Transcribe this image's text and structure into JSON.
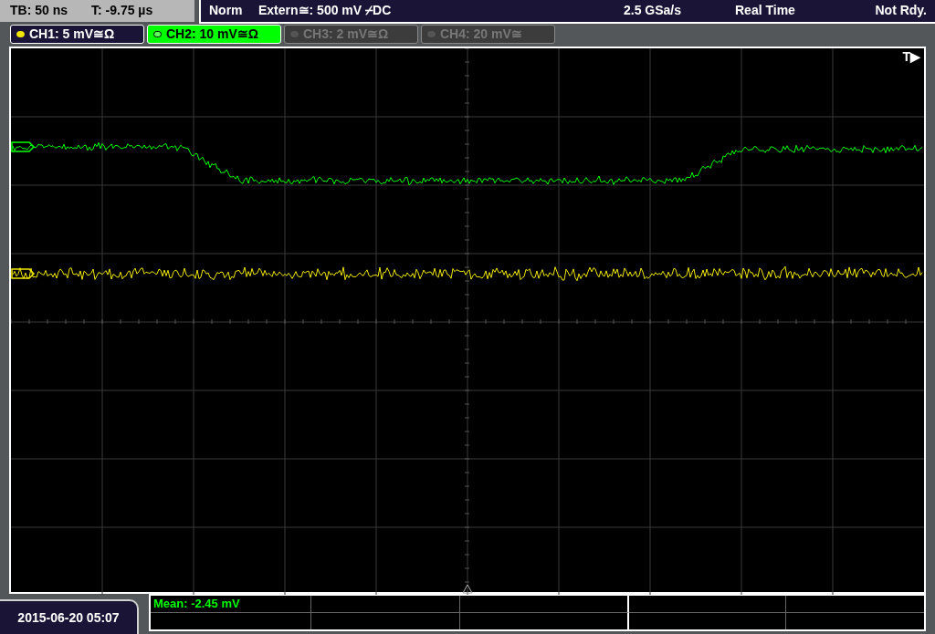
{
  "status_left": {
    "timebase": "TB: 50 ns",
    "trigger_time": "T: -9.75 µs"
  },
  "status_right": {
    "mode": "Norm",
    "trigger_source": "Extern≅: 500 mV ⌿DC",
    "sample_rate": "2.5 GSa/s",
    "acquisition": "Real Time",
    "state": "Not Rdy."
  },
  "channels": [
    {
      "label": "CH1: 5 mV≅Ω",
      "color": "#f0e800",
      "on": true,
      "selected": false
    },
    {
      "label": "CH2: 10 mV≅Ω",
      "color": "#00ff00",
      "on": true,
      "selected": true
    },
    {
      "label": "CH3: 2 mV≅Ω",
      "on": false,
      "selected": false
    },
    {
      "label": "CH4: 20 mV≅",
      "on": false,
      "selected": false
    }
  ],
  "trigger_marker": "T▶",
  "measurements": [
    {
      "text": "Mean: -2.45 mV",
      "color": "#00ff00"
    }
  ],
  "timestamp": "2015-06-20 05:07"
}
